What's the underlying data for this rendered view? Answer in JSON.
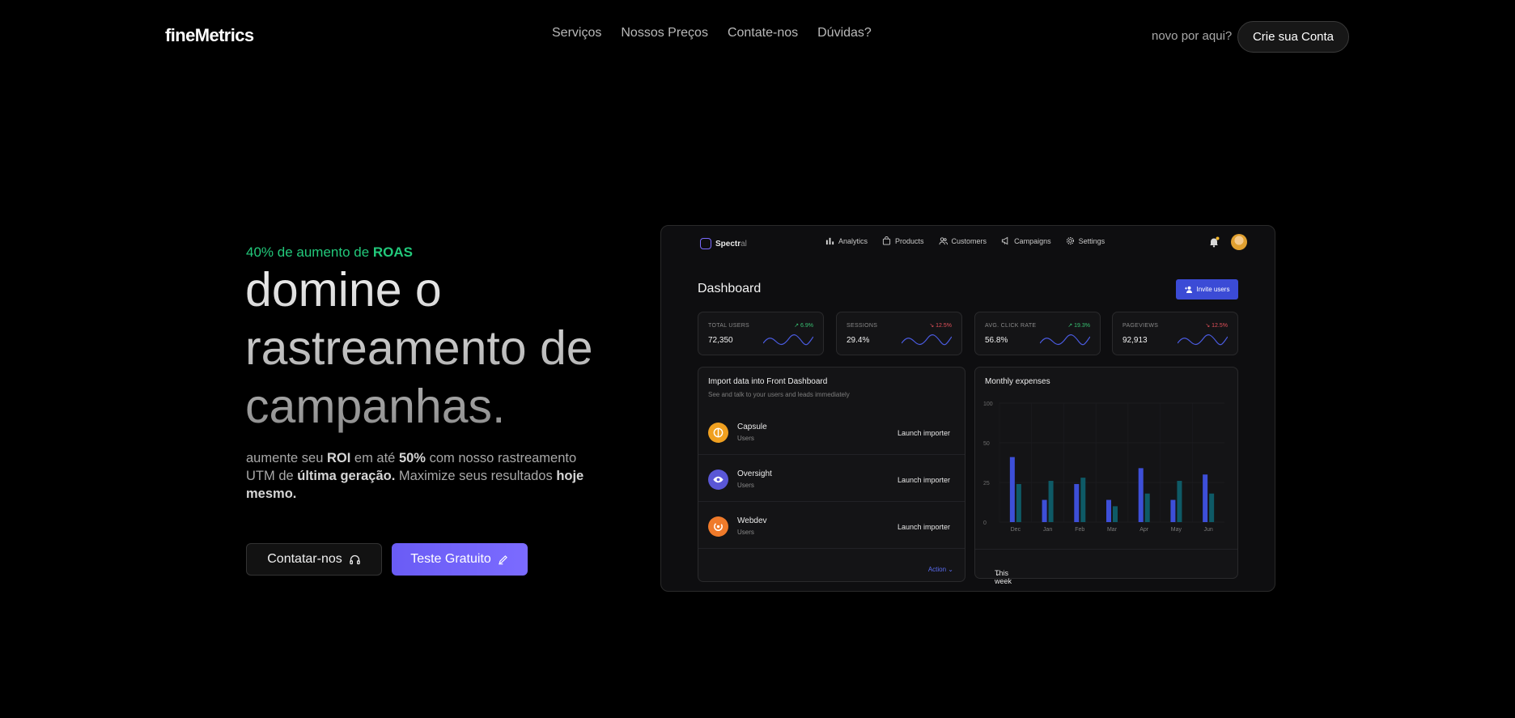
{
  "nav": {
    "logo": "fineMetrics",
    "links": [
      "Serviços",
      "Nossos Preços",
      "Contate-nos",
      "Dúvidas?"
    ],
    "hint": "novo por aqui?",
    "cta": "Crie sua Conta"
  },
  "hero": {
    "eyebrow_prefix": "40% de aumento de ",
    "eyebrow_bold": "ROAS",
    "headline": "domine o rastreamento de campanhas.",
    "sub": {
      "p1": "aumente seu ",
      "b1": "ROI",
      "p2": " em até ",
      "b2": "50%",
      "p3": " com nosso rastreamento UTM de ",
      "b3": "última geração.",
      "p4": " Maximize seus resultados ",
      "b4": "hoje mesmo."
    },
    "btn_contact": "Contatar-nos",
    "btn_trial": "Teste Gratuito",
    "accent": "#22c97b"
  },
  "dashboard": {
    "brand_a": "Spectr",
    "brand_b": "al",
    "nav": [
      {
        "label": "Analytics",
        "icon": "bar-chart-icon"
      },
      {
        "label": "Products",
        "icon": "bag-icon"
      },
      {
        "label": "Customers",
        "icon": "users-icon"
      },
      {
        "label": "Campaigns",
        "icon": "megaphone-icon"
      },
      {
        "label": "Settings",
        "icon": "gear-icon"
      }
    ],
    "title": "Dashboard",
    "invite": "Invite users",
    "stats": [
      {
        "label": "TOTAL USERS",
        "value": "72,350",
        "change": "6.9%",
        "trend": "up"
      },
      {
        "label": "SESSIONS",
        "value": "29.4%",
        "change": "12.5%",
        "trend": "down"
      },
      {
        "label": "AVG. CLICK RATE",
        "value": "56.8%",
        "change": "19.3%",
        "trend": "up"
      },
      {
        "label": "PAGEVIEWS",
        "value": "92,913",
        "change": "12.5%",
        "trend": "down"
      }
    ],
    "import": {
      "title": "Import data into Front Dashboard",
      "subtitle": "See and talk to your users and leads immediately",
      "rows": [
        {
          "name": "Capsule",
          "tag": "Users",
          "action": "Launch importer",
          "color": "#f0a020",
          "icon": "capsule-icon"
        },
        {
          "name": "Oversight",
          "tag": "Users",
          "action": "Launch importer",
          "color": "#5a57d6",
          "icon": "eye-icon"
        },
        {
          "name": "Webdev",
          "tag": "Users",
          "action": "Launch importer",
          "color": "#ef7a2a",
          "icon": "webdev-icon"
        }
      ],
      "action": "Action"
    },
    "expenses": {
      "title": "Monthly expenses",
      "footer": "This week"
    }
  },
  "chart_data": {
    "type": "bar",
    "title": "Monthly expenses",
    "categories": [
      "Dec",
      "Jan",
      "Feb",
      "Mar",
      "Apr",
      "May",
      "Jun"
    ],
    "yticks": [
      0,
      25,
      50,
      100
    ],
    "ylim": [
      0,
      100
    ],
    "series": [
      {
        "values": [
          41,
          14,
          24,
          14,
          34,
          14,
          30
        ],
        "color": "#3d4fd8"
      },
      {
        "values": [
          24,
          26,
          28,
          10,
          18,
          26,
          18
        ],
        "color": "#0e5a66"
      }
    ]
  }
}
